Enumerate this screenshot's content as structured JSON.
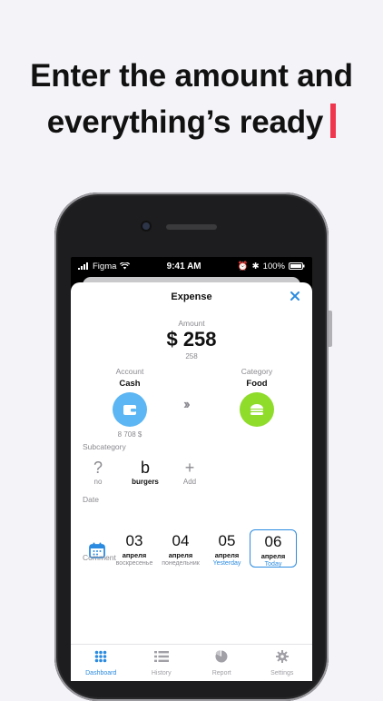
{
  "headline": {
    "line1": "Enter the amount and",
    "line2": "everything’s ready"
  },
  "status": {
    "carrier": "Figma",
    "time": "9:41 AM",
    "battery": "100%"
  },
  "screen": {
    "title": "Expense",
    "amount_label": "Amount",
    "amount": "$ 258",
    "amount_sub": "258",
    "account_label": "Account",
    "account_name": "Cash",
    "account_balance": "8 708 $",
    "category_label": "Category",
    "category_name": "Food",
    "subcategory_label": "Subcategory",
    "subcategories": [
      {
        "glyph": "?",
        "caption": "no"
      },
      {
        "glyph": "b",
        "caption": "burgers"
      },
      {
        "glyph": "+",
        "caption": "Add"
      }
    ],
    "date_label": "Date",
    "dates": [
      {
        "num": "03",
        "month": "апреля",
        "weekday": "воскресенье"
      },
      {
        "num": "04",
        "month": "апреля",
        "weekday": "понедельник"
      },
      {
        "num": "05",
        "month": "апреля",
        "weekday": "Yesterday"
      },
      {
        "num": "06",
        "month": "апреля",
        "weekday": "Today"
      }
    ],
    "comment_label": "Comment"
  },
  "tabs": [
    {
      "label": "Dashboard",
      "icon": "grid-icon",
      "active": true
    },
    {
      "label": "History",
      "icon": "list-icon",
      "active": false
    },
    {
      "label": "Report",
      "icon": "pie-chart-icon",
      "active": false
    },
    {
      "label": "Settings",
      "icon": "gear-icon",
      "active": false
    }
  ],
  "colors": {
    "accent": "#2b8be0",
    "cursor": "#f0364c",
    "account": "#5bb6f3",
    "category": "#8fdc2b"
  }
}
